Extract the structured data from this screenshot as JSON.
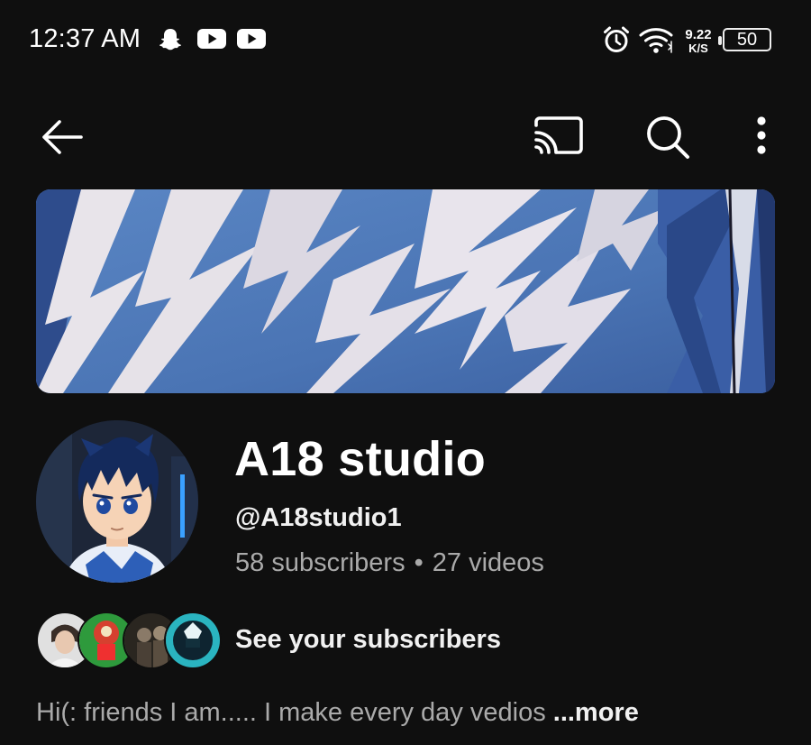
{
  "status_bar": {
    "time": "12:37 AM",
    "net_speed_value": "9.22",
    "net_speed_unit": "K/S",
    "battery": "50",
    "icons": [
      "snapchat-icon",
      "youtube-icon",
      "youtube-icon",
      "alarm-icon",
      "wifi-icon",
      "battery-icon"
    ]
  },
  "toolbar": {
    "icons": [
      "back-arrow-icon",
      "cast-icon",
      "search-icon",
      "more-vert-icon"
    ]
  },
  "channel": {
    "name": "A18 studio",
    "handle": "@A18studio1",
    "subscribers": "58 subscribers",
    "separator": "•",
    "videos": "27 videos"
  },
  "subscribers_row": {
    "label": "See your subscribers"
  },
  "description": {
    "text": "Hi(: friends I am..... I make every day vedios ",
    "more": "...more"
  },
  "colors": {
    "background": "#0f0f0f",
    "primary_text": "#f1f1f1",
    "secondary_text": "#aaaaaa",
    "banner_blue": "#4a74b4"
  }
}
